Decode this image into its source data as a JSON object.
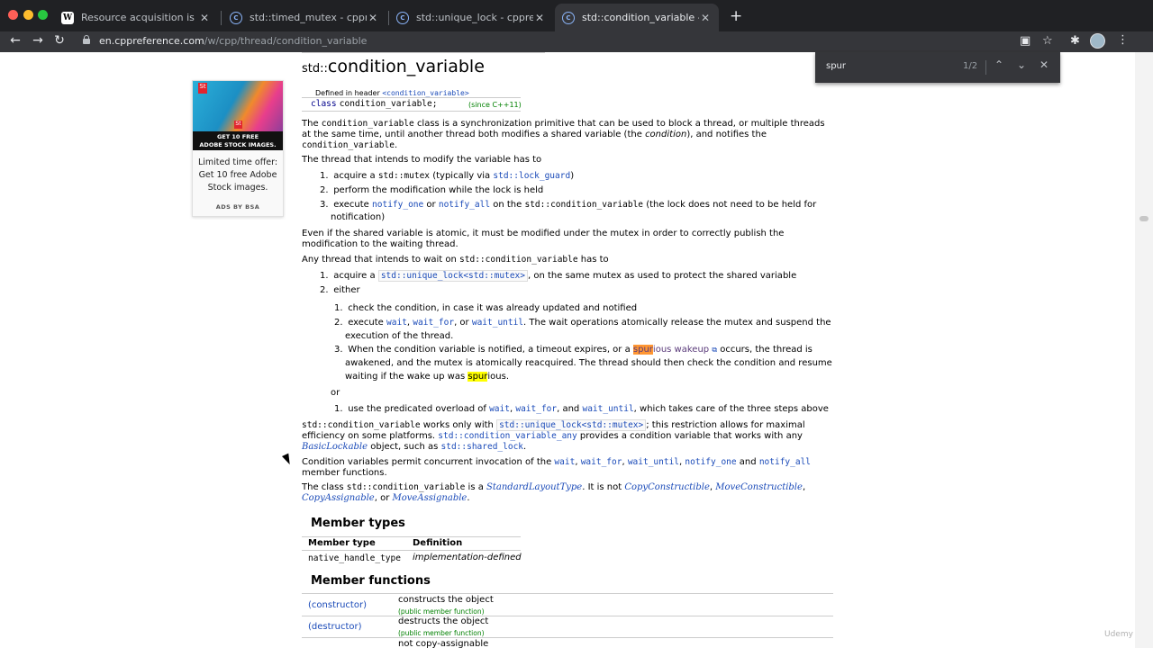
{
  "browser": {
    "tabs": [
      {
        "title": "Resource acquisition is initializ",
        "icon": "wikipedia-icon"
      },
      {
        "title": "std::timed_mutex - cppreferen",
        "icon": "cppreference-icon"
      },
      {
        "title": "std::unique_lock - cppreferenc",
        "icon": "cppreference-icon"
      },
      {
        "title": "std::condition_variable - cppre",
        "icon": "cppreference-icon"
      }
    ],
    "url_host": "en.cppreference.com",
    "url_path": "/w/cpp/thread/condition_variable",
    "favicon_wiki": "W",
    "favicon_cpp": "C",
    "icons": {
      "back": "←",
      "forward": "→",
      "reload": "↻",
      "close": "✕",
      "new_tab": "+",
      "star": "☆",
      "puzzle": "✱",
      "menu": "⋮",
      "doc": "▣"
    }
  },
  "find": {
    "query": "spur",
    "count": "1/2",
    "prev": "⌃",
    "next": "⌄",
    "close": "✕"
  },
  "ad": {
    "logo": "St",
    "badge": "St",
    "banner_line1": "GET 10 FREE",
    "banner_line2": "ADOBE STOCK IMAGES.",
    "text_line1": "Limited time offer:",
    "text_line2": "Get 10 free Adobe",
    "text_line3": "Stock images.",
    "footer": "ADS BY BSA"
  },
  "page": {
    "title_ns": "std::",
    "title_main": "condition_variable",
    "defined_in": "Defined in header",
    "header_name": "<condition_variable>",
    "decl_kw": "class",
    "decl_name": "condition_variable;",
    "since": "(since C++11)",
    "intro_1": "The",
    "intro_code": "condition_variable",
    "intro_2": "class is a synchronization primitive that can be used to block a thread, or multiple threads",
    "intro_3": "at the same time, until another thread both modifies a shared variable (the",
    "intro_em": "condition",
    "intro_4": "), and notifies the",
    "intro_code2": "condition_variable",
    "intro_5": ".",
    "modify_lead": "The thread that intends to modify the variable has to",
    "modify_items": {
      "n1": "1.",
      "i1a": "acquire a",
      "i1code": "std::mutex",
      "i1b": "(typically via",
      "i1link": "std::lock_guard",
      "i1c": ")",
      "n2": "2.",
      "i2": "perform the modification while the lock is held",
      "n3": "3.",
      "i3a": "execute",
      "i3l1": "notify_one",
      "i3b": "or",
      "i3l2": "notify_all",
      "i3c": "on the",
      "i3code": "std::condition_variable",
      "i3d": "(the lock does not need to be held for",
      "i3e": "notification)"
    },
    "atomic_1": "Even if the shared variable is atomic, it must be modified under the mutex in order to correctly publish the",
    "atomic_2": "modification to the waiting thread.",
    "wait_lead_1": "Any thread that intends to wait on",
    "wait_lead_code": "std::condition_variable",
    "wait_lead_2": "has to",
    "wait_items": {
      "n1": "1.",
      "w1a": "acquire a",
      "w1code": "std::unique_lock<std::mutex>",
      "w1b": ", on the same mutex as used to protect the shared variable",
      "n2": "2.",
      "w2": "either",
      "s1n": "1.",
      "s1": "check the condition, in case it was already updated and notified",
      "s2n": "2.",
      "s2a": "execute",
      "s2l1": "wait",
      "s2b": ",",
      "s2l2": "wait_for",
      "s2c": ", or",
      "s2l3": "wait_until",
      "s2d": ". The wait operations atomically release the mutex and suspend the",
      "s2e": "execution of the thread.",
      "s3n": "3.",
      "s3a": "When the condition variable is notified, a timeout expires, or a",
      "s3hl": "spur",
      "s3l": "ious wakeup",
      "s3ext": "⧉",
      "s3b": "occurs, the thread is",
      "s3c": "awakened, and the mutex is atomically reacquired. The thread should then check the condition and resume",
      "s3d": "waiting if the wake up was",
      "s3hl2": "spur",
      "s3e": "ious.",
      "or": "or",
      "p1n": "1.",
      "p1a": "use the predicated overload of",
      "p1l1": "wait",
      "p1b": ",",
      "p1l2": "wait_for",
      "p1c": ", and",
      "p1l3": "wait_until",
      "p1d": ", which takes care of the three steps above"
    },
    "works_code": "std::condition_variable",
    "works_1": "works only with",
    "works_code2": "std::unique_lock<std::mutex>",
    "works_2": "; this restriction allows for maximal",
    "works_3": "efficiency on some platforms.",
    "works_link": "std::condition_variable_any",
    "works_4": "provides a condition variable that works with any",
    "works_italic": "BasicLockable",
    "works_5": "object, such as",
    "works_link2": "std::shared_lock",
    "works_6": ".",
    "concurrent_1": "Condition variables permit concurrent invocation of the",
    "c_l1": "wait",
    "c_l2": "wait_for",
    "c_l3": "wait_until",
    "c_l4": "notify_one",
    "c_and": "and",
    "c_l5": "notify_all",
    "comma": ",",
    "concurrent_2": "member functions.",
    "class_1": "The class",
    "class_code": "std::condition_variable",
    "class_2": "is a",
    "class_l1": "StandardLayoutType",
    "class_3": ". It is not",
    "class_l2": "CopyConstructible",
    "class_l3": "MoveConstructible",
    "class_l4": "CopyAssignable",
    "class_or": ", or",
    "class_l5": "MoveAssignable",
    "class_end": "."
  },
  "member_types": {
    "heading": "Member types",
    "col1": "Member type",
    "col2": "Definition",
    "row_name": "native_handle_type",
    "row_def": "implementation-defined"
  },
  "member_functions": {
    "heading": "Member functions",
    "rows": [
      {
        "name": "(constructor)",
        "desc": "constructs the object",
        "kind": "(public member function)"
      },
      {
        "name": "(destructor)",
        "desc": "destructs the object",
        "kind": "(public member function)"
      },
      {
        "name": "",
        "desc": "not copy-assignable",
        "kind": ""
      }
    ]
  },
  "watermark": "Udemy"
}
